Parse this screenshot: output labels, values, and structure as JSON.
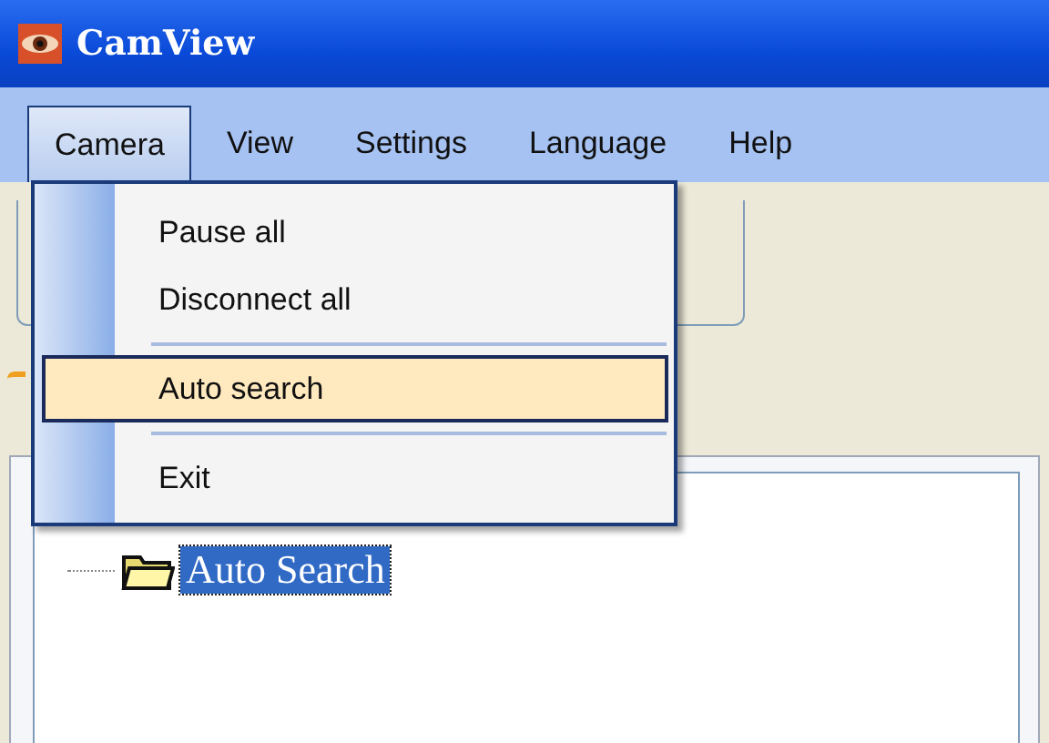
{
  "window": {
    "title": "CamView"
  },
  "menu_bar": [
    {
      "label": "Camera",
      "selected": true
    },
    {
      "label": "View",
      "selected": false
    },
    {
      "label": "Settings",
      "selected": false
    },
    {
      "label": "Language",
      "selected": false
    },
    {
      "label": "Help",
      "selected": false
    }
  ],
  "open_menu": [
    {
      "kind": "item",
      "label": "Pause all",
      "selected": false
    },
    {
      "kind": "item",
      "label": "Disconnect all",
      "selected": false
    },
    {
      "kind": "separator"
    },
    {
      "kind": "item",
      "label": "Auto search",
      "selected": true
    },
    {
      "kind": "separator"
    },
    {
      "kind": "item",
      "label": "Exit",
      "selected": false
    }
  ],
  "tree": [
    {
      "label": "Auto Search",
      "selected": true
    }
  ]
}
